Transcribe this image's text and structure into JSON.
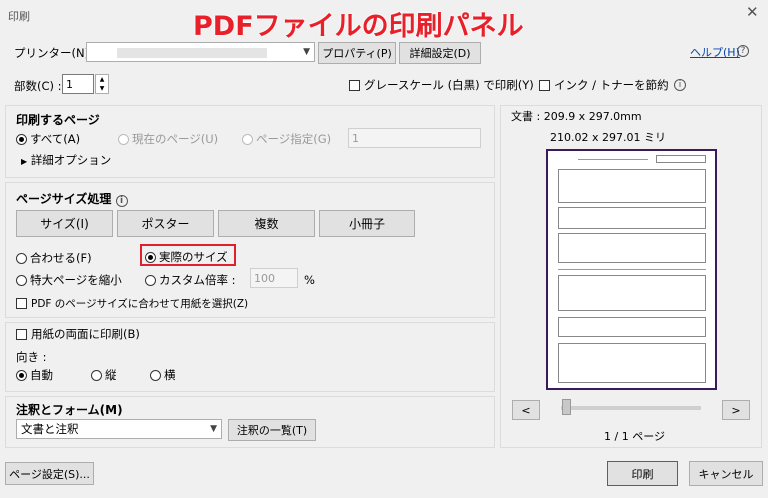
{
  "window": {
    "title": "印刷",
    "banner": "PDFファイルの印刷パネル"
  },
  "header": {
    "printer_label": "プリンター(N) :",
    "properties_button": "プロパティ(P)",
    "advanced_button": "詳細設定(D)",
    "help_link": "ヘルプ(H)",
    "copies_label": "部数(C) :",
    "copies_value": "1",
    "grayscale_label": "グレースケール (白黒) で印刷(Y)",
    "ink_save_label": "インク / トナーを節約"
  },
  "pages": {
    "title": "印刷するページ",
    "all": "すべて(A)",
    "current": "現在のページ(U)",
    "range": "ページ指定(G)",
    "range_value": "1",
    "more_options": "詳細オプション"
  },
  "sizing": {
    "title": "ページサイズ処理",
    "tabs": [
      "サイズ(I)",
      "ポスター",
      "複数",
      "小冊子"
    ],
    "fit": "合わせる(F)",
    "actual": "実際のサイズ",
    "shrink": "特大ページを縮小",
    "custom": "カスタム倍率 :",
    "custom_value": "100",
    "percent": "%",
    "choose_paper": "PDF のページサイズに合わせて用紙を選択(Z)"
  },
  "duplex": {
    "label": "用紙の両面に印刷(B)",
    "orientation_label": "向き :",
    "auto": "自動",
    "portrait": "縦",
    "landscape": "横"
  },
  "comments": {
    "title": "注釈とフォーム(M)",
    "value": "文書と注釈",
    "summary_button": "注釈の一覧(T)"
  },
  "preview": {
    "doc_label": "文書 : 209.9 x 297.0mm",
    "size_label": "210.02 x 297.01 ミリ",
    "prev": "<",
    "next": ">",
    "page_indicator": "1 / 1 ページ"
  },
  "footer": {
    "page_setup": "ページ設定(S)...",
    "print": "印刷",
    "cancel": "キャンセル"
  },
  "colors": {
    "banner": "#e8202a",
    "highlight": "#e0202a",
    "preview_border": "#3a1a5a"
  }
}
